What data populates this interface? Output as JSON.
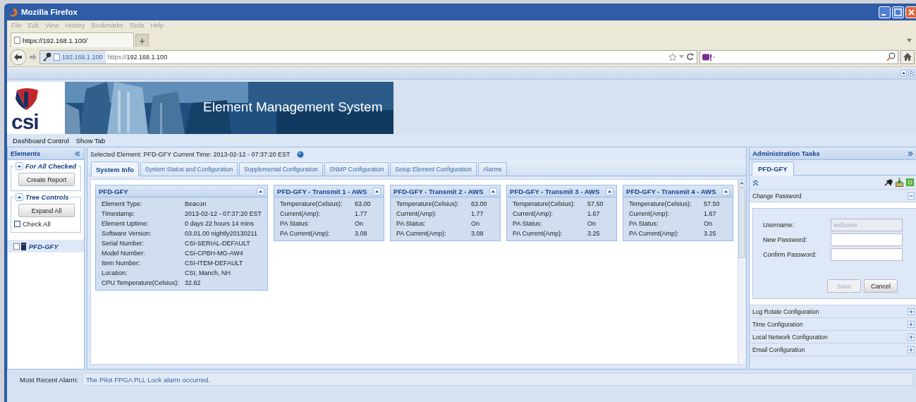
{
  "window": {
    "title": "Mozilla Firefox"
  },
  "menu": [
    "File",
    "Edit",
    "View",
    "History",
    "Bookmarks",
    "Tools",
    "Help"
  ],
  "browser_tab": {
    "label": "https://192.168.1.100/"
  },
  "new_tab": "+",
  "address_bar": {
    "site": "192.168.1.100",
    "url_scheme": "https://",
    "url_host": "192.168.1.100"
  },
  "banner": {
    "logo": "csi",
    "title": "Element Management System"
  },
  "nav_menu": [
    "Dashboard Control",
    "Show Tab"
  ],
  "elements_panel": {
    "title": "Elements",
    "groups": [
      {
        "legend": "For All Checked",
        "button": "Create Report"
      },
      {
        "legend": "Tree Controls",
        "button": "Expand All",
        "checkbox": {
          "label": "Check All",
          "checked": false
        }
      }
    ],
    "tree": [
      {
        "label": "PFD-GFY",
        "checked": false,
        "selected": true
      }
    ]
  },
  "header": {
    "text": "Selected Element:  PFD-GFY  Current Time: 2013-02-12 - 07:37:20 EST"
  },
  "tabs": [
    {
      "label": "System Info",
      "selected": true
    },
    {
      "label": "System Status and Configuration",
      "selected": false
    },
    {
      "label": "Supplemental Configuration",
      "selected": false
    },
    {
      "label": "SNMP Configuration",
      "selected": false
    },
    {
      "label": "Setup Element Configuration",
      "selected": false
    },
    {
      "label": "Alarms",
      "selected": false
    }
  ],
  "cards": [
    {
      "title": "PFD-GFY",
      "kind": "wide",
      "rows": [
        {
          "label": "Element Type:",
          "value": "Beacon"
        },
        {
          "label": "Timestamp:",
          "value": "2013-02-12 - 07:37:20 EST"
        },
        {
          "label": "Element Uptime:",
          "value": "0 days 22 hours 14 mins"
        },
        {
          "label": "Software Version:",
          "value": "03.01.00 nightly20130211"
        },
        {
          "label": "Serial Number:",
          "value": "CSI-SERIAL-DEFAULT"
        },
        {
          "label": "Model Number:",
          "value": "CSI-CPBH-MG-AW4"
        },
        {
          "label": "Item Number:",
          "value": "CSI-ITEM-DEFAULT"
        },
        {
          "label": "Location:",
          "value": "CSI, Manch, NH"
        },
        {
          "label": "CPU Temperature(Celsius):",
          "value": "32.62"
        }
      ]
    },
    {
      "title": "PFD-GFY - Transmit 1 - AWS",
      "kind": "narrow",
      "rows": [
        {
          "label": "Temperature(Celsius):",
          "value": "63.00"
        },
        {
          "label": "Current(Amp):",
          "value": "1.77"
        },
        {
          "label": "PA Status:",
          "value": "On"
        },
        {
          "label": "PA Current(Amp):",
          "value": "3.08"
        }
      ]
    },
    {
      "title": "PFD-GFY - Transmit 2 - AWS",
      "kind": "narrow",
      "rows": [
        {
          "label": "Temperature(Celsius):",
          "value": "63.00"
        },
        {
          "label": "Current(Amp):",
          "value": "1.77"
        },
        {
          "label": "PA Status:",
          "value": "On"
        },
        {
          "label": "PA Current(Amp):",
          "value": "3.08"
        }
      ]
    },
    {
      "title": "PFD-GFY - Transmit 3 - AWS",
      "kind": "narrow",
      "rows": [
        {
          "label": "Temperature(Celsius):",
          "value": "57.50"
        },
        {
          "label": "Current(Amp):",
          "value": "1.67"
        },
        {
          "label": "PA Status:",
          "value": "On"
        },
        {
          "label": "PA Current(Amp):",
          "value": "3.25"
        }
      ]
    },
    {
      "title": "PFD-GFY - Transmit 4 - AWS",
      "kind": "narrow",
      "rows": [
        {
          "label": "Temperature(Celsius):",
          "value": "57.50"
        },
        {
          "label": "Current(Amp):",
          "value": "1.67"
        },
        {
          "label": "PA Status:",
          "value": "On"
        },
        {
          "label": "PA Current(Amp):",
          "value": "3.25"
        }
      ]
    }
  ],
  "admin": {
    "title": "Administration Tasks",
    "tab": {
      "label": "PFD-GFY",
      "selected": true
    },
    "sections": [
      {
        "title": "Change Password",
        "expanded": true
      },
      {
        "title": "Log Rotate Configuration",
        "expanded": false
      },
      {
        "title": "Time Configuration",
        "expanded": false
      },
      {
        "title": "Local Network Configuration",
        "expanded": false
      },
      {
        "title": "Email Configuration",
        "expanded": false
      }
    ],
    "form": {
      "fields": [
        {
          "label": "Username:",
          "value": "webuser",
          "disabled": true
        },
        {
          "label": "New Password:",
          "disabled": false
        },
        {
          "label": "Confirm Password:",
          "disabled": false
        }
      ],
      "buttons": [
        {
          "label": "Save",
          "disabled": true
        },
        {
          "label": "Cancel",
          "disabled": false
        }
      ]
    }
  },
  "status_bar": {
    "label": "Most Recent Alarm:",
    "message": "The Pilot FPGA PLL Lock alarm occurred."
  }
}
